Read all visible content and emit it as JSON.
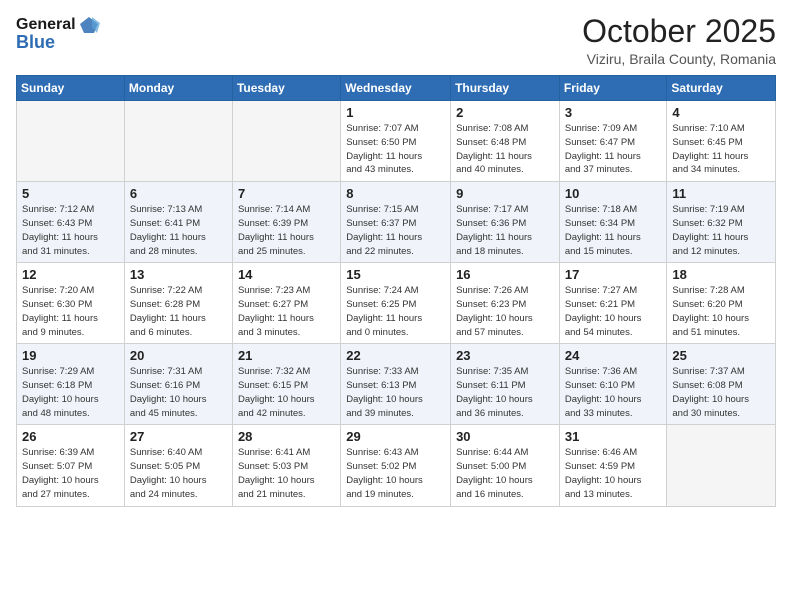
{
  "logo": {
    "general": "General",
    "blue": "Blue"
  },
  "title": "October 2025",
  "location": "Viziru, Braila County, Romania",
  "weekdays": [
    "Sunday",
    "Monday",
    "Tuesday",
    "Wednesday",
    "Thursday",
    "Friday",
    "Saturday"
  ],
  "weeks": [
    [
      {
        "day": "",
        "info": ""
      },
      {
        "day": "",
        "info": ""
      },
      {
        "day": "",
        "info": ""
      },
      {
        "day": "1",
        "info": "Sunrise: 7:07 AM\nSunset: 6:50 PM\nDaylight: 11 hours\nand 43 minutes."
      },
      {
        "day": "2",
        "info": "Sunrise: 7:08 AM\nSunset: 6:48 PM\nDaylight: 11 hours\nand 40 minutes."
      },
      {
        "day": "3",
        "info": "Sunrise: 7:09 AM\nSunset: 6:47 PM\nDaylight: 11 hours\nand 37 minutes."
      },
      {
        "day": "4",
        "info": "Sunrise: 7:10 AM\nSunset: 6:45 PM\nDaylight: 11 hours\nand 34 minutes."
      }
    ],
    [
      {
        "day": "5",
        "info": "Sunrise: 7:12 AM\nSunset: 6:43 PM\nDaylight: 11 hours\nand 31 minutes."
      },
      {
        "day": "6",
        "info": "Sunrise: 7:13 AM\nSunset: 6:41 PM\nDaylight: 11 hours\nand 28 minutes."
      },
      {
        "day": "7",
        "info": "Sunrise: 7:14 AM\nSunset: 6:39 PM\nDaylight: 11 hours\nand 25 minutes."
      },
      {
        "day": "8",
        "info": "Sunrise: 7:15 AM\nSunset: 6:37 PM\nDaylight: 11 hours\nand 22 minutes."
      },
      {
        "day": "9",
        "info": "Sunrise: 7:17 AM\nSunset: 6:36 PM\nDaylight: 11 hours\nand 18 minutes."
      },
      {
        "day": "10",
        "info": "Sunrise: 7:18 AM\nSunset: 6:34 PM\nDaylight: 11 hours\nand 15 minutes."
      },
      {
        "day": "11",
        "info": "Sunrise: 7:19 AM\nSunset: 6:32 PM\nDaylight: 11 hours\nand 12 minutes."
      }
    ],
    [
      {
        "day": "12",
        "info": "Sunrise: 7:20 AM\nSunset: 6:30 PM\nDaylight: 11 hours\nand 9 minutes."
      },
      {
        "day": "13",
        "info": "Sunrise: 7:22 AM\nSunset: 6:28 PM\nDaylight: 11 hours\nand 6 minutes."
      },
      {
        "day": "14",
        "info": "Sunrise: 7:23 AM\nSunset: 6:27 PM\nDaylight: 11 hours\nand 3 minutes."
      },
      {
        "day": "15",
        "info": "Sunrise: 7:24 AM\nSunset: 6:25 PM\nDaylight: 11 hours\nand 0 minutes."
      },
      {
        "day": "16",
        "info": "Sunrise: 7:26 AM\nSunset: 6:23 PM\nDaylight: 10 hours\nand 57 minutes."
      },
      {
        "day": "17",
        "info": "Sunrise: 7:27 AM\nSunset: 6:21 PM\nDaylight: 10 hours\nand 54 minutes."
      },
      {
        "day": "18",
        "info": "Sunrise: 7:28 AM\nSunset: 6:20 PM\nDaylight: 10 hours\nand 51 minutes."
      }
    ],
    [
      {
        "day": "19",
        "info": "Sunrise: 7:29 AM\nSunset: 6:18 PM\nDaylight: 10 hours\nand 48 minutes."
      },
      {
        "day": "20",
        "info": "Sunrise: 7:31 AM\nSunset: 6:16 PM\nDaylight: 10 hours\nand 45 minutes."
      },
      {
        "day": "21",
        "info": "Sunrise: 7:32 AM\nSunset: 6:15 PM\nDaylight: 10 hours\nand 42 minutes."
      },
      {
        "day": "22",
        "info": "Sunrise: 7:33 AM\nSunset: 6:13 PM\nDaylight: 10 hours\nand 39 minutes."
      },
      {
        "day": "23",
        "info": "Sunrise: 7:35 AM\nSunset: 6:11 PM\nDaylight: 10 hours\nand 36 minutes."
      },
      {
        "day": "24",
        "info": "Sunrise: 7:36 AM\nSunset: 6:10 PM\nDaylight: 10 hours\nand 33 minutes."
      },
      {
        "day": "25",
        "info": "Sunrise: 7:37 AM\nSunset: 6:08 PM\nDaylight: 10 hours\nand 30 minutes."
      }
    ],
    [
      {
        "day": "26",
        "info": "Sunrise: 6:39 AM\nSunset: 5:07 PM\nDaylight: 10 hours\nand 27 minutes."
      },
      {
        "day": "27",
        "info": "Sunrise: 6:40 AM\nSunset: 5:05 PM\nDaylight: 10 hours\nand 24 minutes."
      },
      {
        "day": "28",
        "info": "Sunrise: 6:41 AM\nSunset: 5:03 PM\nDaylight: 10 hours\nand 21 minutes."
      },
      {
        "day": "29",
        "info": "Sunrise: 6:43 AM\nSunset: 5:02 PM\nDaylight: 10 hours\nand 19 minutes."
      },
      {
        "day": "30",
        "info": "Sunrise: 6:44 AM\nSunset: 5:00 PM\nDaylight: 10 hours\nand 16 minutes."
      },
      {
        "day": "31",
        "info": "Sunrise: 6:46 AM\nSunset: 4:59 PM\nDaylight: 10 hours\nand 13 minutes."
      },
      {
        "day": "",
        "info": ""
      }
    ]
  ]
}
